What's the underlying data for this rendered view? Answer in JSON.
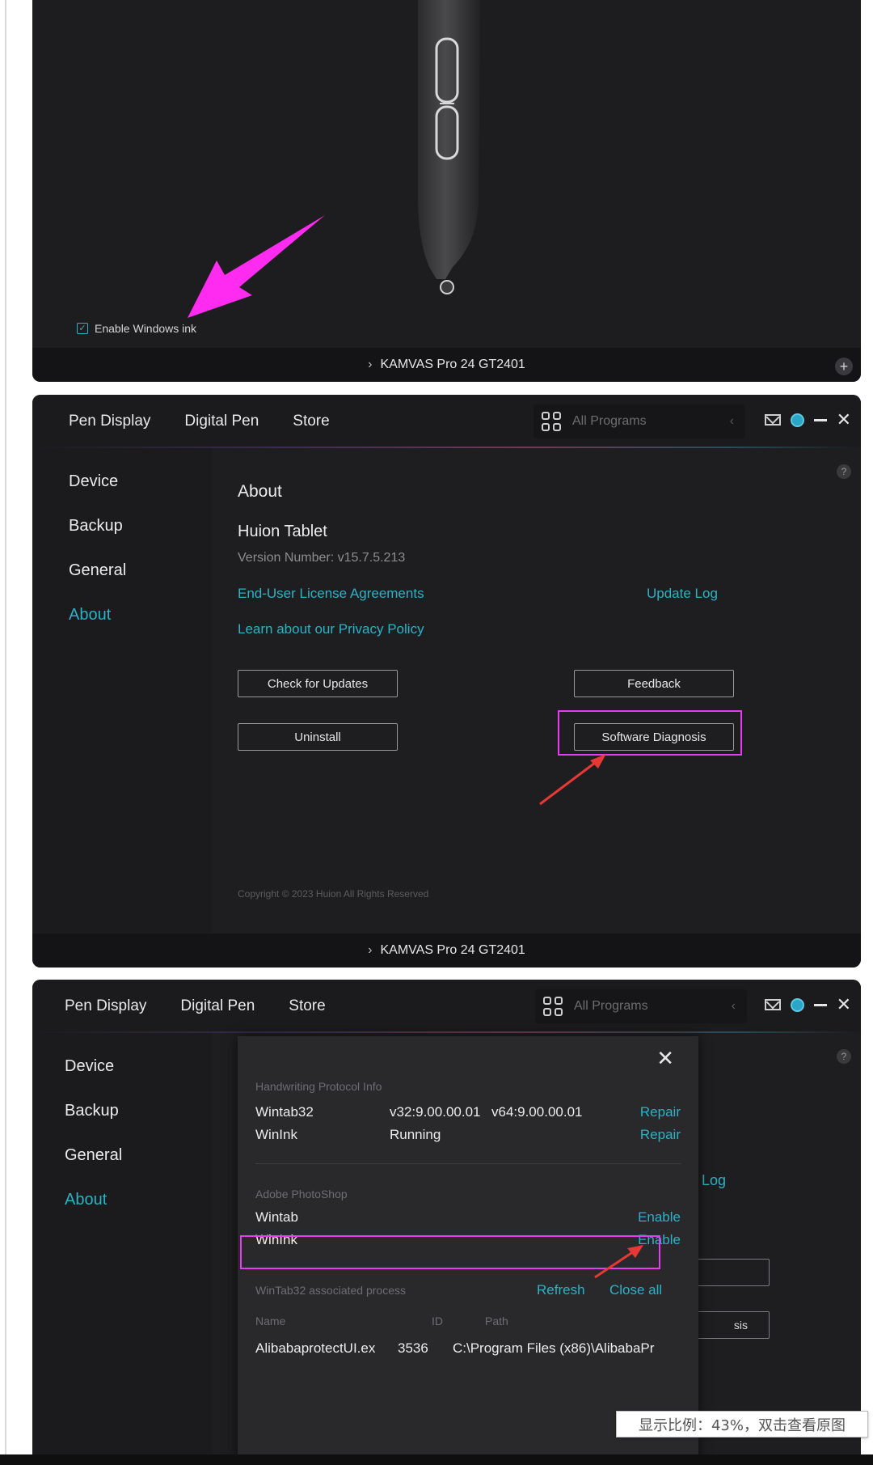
{
  "panel1": {
    "ink_checkbox": {
      "label": "Enable Windows ink",
      "checked": true,
      "check_glyph": "✓"
    },
    "device_bar": {
      "chevron": "›",
      "device": "KAMVAS Pro 24 GT2401"
    },
    "plus_glyph": "+"
  },
  "panel2": {
    "tabs": [
      "Pen Display",
      "Digital Pen",
      "Store"
    ],
    "program_search": {
      "placeholder": "All Programs",
      "chevron": "‹"
    },
    "window_close": "✕",
    "sidebar": [
      {
        "label": "Device",
        "active": false
      },
      {
        "label": "Backup",
        "active": false
      },
      {
        "label": "General",
        "active": false
      },
      {
        "label": "About",
        "active": true
      }
    ],
    "help": "?",
    "about_title": "About",
    "app_name": "Huion Tablet",
    "version": "Version Number: v15.7.5.213",
    "links": {
      "eula": "End-User License Agreements",
      "update_log": "Update Log",
      "privacy": "Learn about our Privacy Policy"
    },
    "buttons": {
      "check_updates": "Check for Updates",
      "feedback": "Feedback",
      "uninstall": "Uninstall",
      "software_diagnosis": "Software Diagnosis"
    },
    "copyright": "Copyright © 2023 Huion All Rights Reserved",
    "device_bar": {
      "chevron": "›",
      "device": "KAMVAS Pro 24 GT2401"
    }
  },
  "panel3": {
    "tabs": [
      "Pen Display",
      "Digital Pen",
      "Store"
    ],
    "program_search": {
      "placeholder": "All Programs",
      "chevron": "‹"
    },
    "window_close": "✕",
    "sidebar": [
      {
        "label": "Device",
        "active": false
      },
      {
        "label": "Backup",
        "active": false
      },
      {
        "label": "General",
        "active": false
      },
      {
        "label": "About",
        "active": true
      }
    ],
    "help": "?",
    "background_fragments": {
      "log": "Log",
      "sis": "sis"
    },
    "modal": {
      "close": "✕",
      "handwriting_section": "Handwriting Protocol Info",
      "wintab32": {
        "name": "Wintab32",
        "v32": "v32:9.00.00.01",
        "v64": "v64:9.00.00.01",
        "action": "Repair"
      },
      "winink": {
        "name": "WinInk",
        "status": "Running",
        "action": "Repair"
      },
      "photoshop_section": "Adobe PhotoShop",
      "ps_wintab": {
        "name": "Wintab",
        "action": "Enable"
      },
      "ps_winink": {
        "name": "WinInk",
        "action": "Enable"
      },
      "process_section": "WinTab32 associated process",
      "refresh": "Refresh",
      "close_all": "Close all",
      "columns": {
        "name": "Name",
        "id": "ID",
        "path": "Path"
      },
      "process_row": {
        "name": "AlibabaprotectUI.ex",
        "id": "3536",
        "path": "C:\\Program Files (x86)\\AlibabaPr"
      }
    }
  },
  "zoom_tooltip": "显示比例：43%，双击查看原图",
  "colors": {
    "accent": "#2ab3c7",
    "highlight": "#e43cf0",
    "arrow_magenta": "#ff2bf0",
    "arrow_red": "#e53935",
    "panel_bg": "#1e1e20"
  }
}
